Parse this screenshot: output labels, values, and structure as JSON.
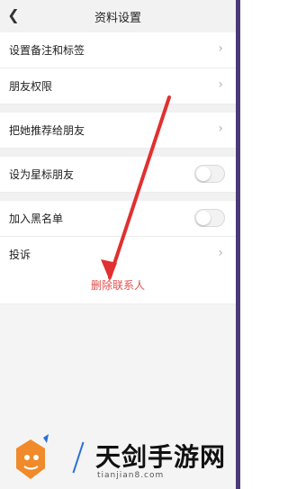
{
  "header": {
    "title": "资料设置",
    "back_icon": "chevron-left-icon"
  },
  "rows": [
    {
      "label": "设置备注和标签",
      "type": "link"
    },
    {
      "label": "朋友权限",
      "type": "link"
    },
    {
      "label": "把她推荐给朋友",
      "type": "link"
    },
    {
      "label": "设为星标朋友",
      "type": "toggle",
      "on": false
    },
    {
      "label": "加入黑名单",
      "type": "toggle",
      "on": false
    },
    {
      "label": "投诉",
      "type": "link"
    }
  ],
  "delete_contact": {
    "label": "删除联系人",
    "color": "#e05050"
  },
  "annotation": {
    "arrow_color": "#e03030"
  },
  "watermark": {
    "brand": "天剑手游网",
    "url": "tianjian8.com"
  },
  "colors": {
    "accent_red": "#e05050",
    "right_strip": "#4a3a78"
  }
}
